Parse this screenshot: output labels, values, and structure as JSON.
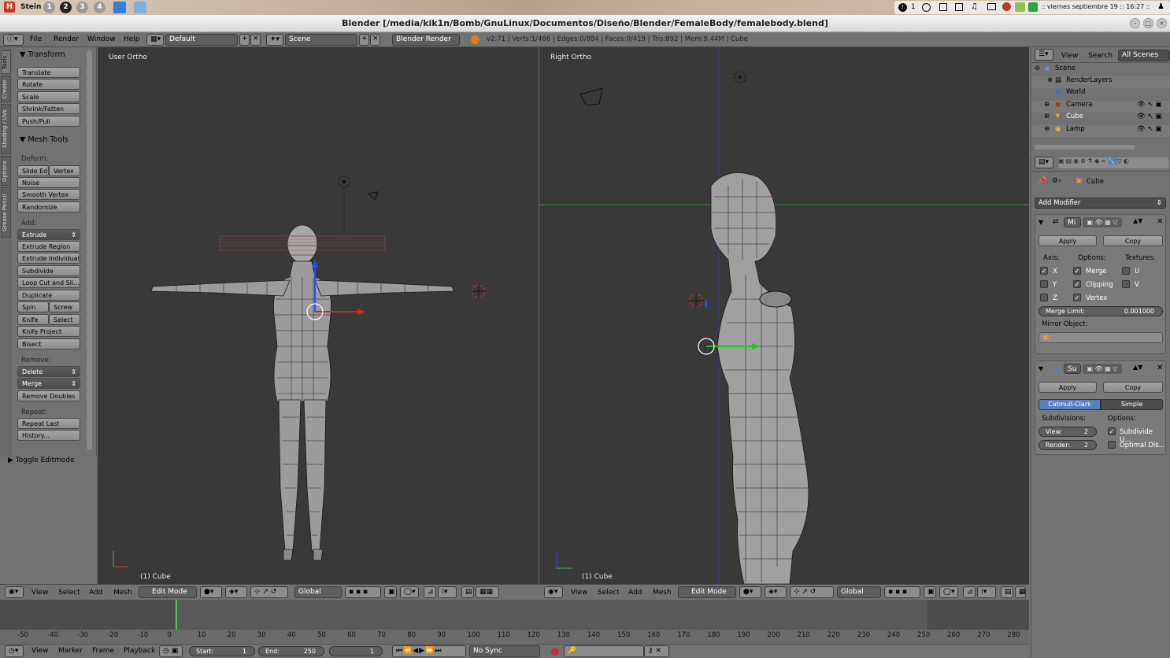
{
  "system_bar": {
    "user": "Stein",
    "workspaces": [
      "1",
      "2",
      "3",
      "4"
    ],
    "active_workspace": "2",
    "clock": ":: viernes septiembre 19 :: 16:27 ::",
    "indicator": "1"
  },
  "window": {
    "title": "Blender [/media/kik1n/Bomb/GnuLinux/Documentos/Diseño/Blender/FemaleBody/femalebody.blend]"
  },
  "header": {
    "menus": [
      "File",
      "Render",
      "Window",
      "Help"
    ],
    "layout": "Default",
    "scene": "Scene",
    "engine": "Blender Render",
    "stats": "v2.71 | Verts:1/466 | Edges:0/884 | Faces:0/419 | Tris:892 | Mem:9.44M | Cube"
  },
  "tool_tabs": [
    "Tools",
    "Create",
    "Shading / UVs",
    "Options",
    "Grease Pencil"
  ],
  "shelf": {
    "transform_title": "Transform",
    "transform_buttons": [
      "Translate",
      "Rotate",
      "Scale",
      "Shrink/Fatten",
      "Push/Pull"
    ],
    "mesh_tools_title": "Mesh Tools",
    "deform_label": "Deform:",
    "slide_edge": "Slide Ed",
    "vertex": "Vertex",
    "noise": "Noise",
    "smooth_vertex": "Smooth Vertex",
    "randomize": "Randomize",
    "add_label": "Add:",
    "extrude": "Extrude",
    "extrude_region": "Extrude Region",
    "extrude_individual": "Extrude Individual",
    "subdivide": "Subdivide",
    "loop_cut": "Loop Cut and Sli...",
    "duplicate": "Duplicate",
    "spin": "Spin",
    "screw": "Screw",
    "knife": "Knife",
    "select": "Select",
    "knife_project": "Knife Project",
    "bisect": "Bisect",
    "remove_label": "Remove:",
    "delete": "Delete",
    "merge": "Merge",
    "remove_doubles": "Remove Doubles",
    "repeat_label": "Repeat:",
    "repeat_last": "Repeat Last",
    "history": "History...",
    "toggle_editmode": "Toggle Editmode"
  },
  "viewport_left": {
    "name": "User Ortho",
    "object": "(1) Cube",
    "menus": [
      "View",
      "Select",
      "Add",
      "Mesh"
    ],
    "mode": "Edit Mode",
    "orientation": "Global"
  },
  "viewport_right": {
    "name": "Right Ortho",
    "object": "(1) Cube",
    "menus": [
      "View",
      "Select",
      "Add",
      "Mesh"
    ],
    "mode": "Edit Mode",
    "orientation": "Global"
  },
  "outliner": {
    "menus": [
      "View",
      "Search"
    ],
    "filter": "All Scenes",
    "items": [
      "Scene",
      "RenderLayers",
      "World",
      "Camera",
      "Cube",
      "Lamp"
    ]
  },
  "properties": {
    "object_name": "Cube",
    "add_modifier": "Add Modifier",
    "mirror": {
      "name": "Mi",
      "apply": "Apply",
      "copy": "Copy",
      "axis_label": "Axis:",
      "options_label": "Options:",
      "textures_label": "Textures:",
      "axis": [
        "X",
        "Y",
        "Z"
      ],
      "options": [
        "Merge",
        "Clipping",
        "Vertex"
      ],
      "textures": [
        "U",
        "V"
      ],
      "merge_limit": "Merge Limit:",
      "merge_limit_value": "0.001000",
      "mirror_object": "Mirror Object:"
    },
    "subsurf": {
      "name": "Su",
      "apply": "Apply",
      "copy": "Copy",
      "tab_catmull": "Catmull-Clark",
      "tab_simple": "Simple",
      "subdivisions_label": "Subdivisions:",
      "options_label": "Options:",
      "view": "View:",
      "view_value": "2",
      "render": "Render:",
      "render_value": "2",
      "subdivide_uvs": "Subdivide U...",
      "optimal_display": "Optimal Dis..."
    }
  },
  "timeline": {
    "ticks": [
      "-50",
      "-40",
      "-30",
      "-20",
      "-10",
      "0",
      "10",
      "20",
      "30",
      "40",
      "50",
      "60",
      "70",
      "80",
      "90",
      "100",
      "110",
      "120",
      "130",
      "140",
      "150",
      "160",
      "170",
      "180",
      "190",
      "200",
      "210",
      "220",
      "230",
      "240",
      "250",
      "260",
      "270",
      "280"
    ],
    "menus": [
      "View",
      "Marker",
      "Frame",
      "Playback"
    ],
    "start": "Start:",
    "start_value": "1",
    "end": "End:",
    "end_value": "250",
    "current": "1",
    "sync": "No Sync"
  }
}
